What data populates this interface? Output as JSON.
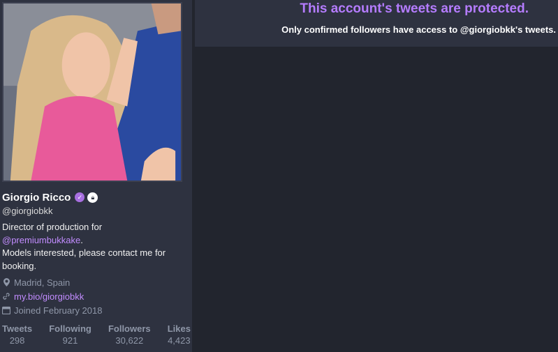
{
  "profile": {
    "fullname": "Giorgio Ricco",
    "handle": "@giorgiobkk",
    "bio_line1": "Director of production for",
    "bio_mention": "@premiumbukkake",
    "bio_after_mention": ".",
    "bio_line2": "Models interested, please contact me for booking.",
    "location": "Madrid, Spain",
    "website": "my.bio/giorgiobkk",
    "joined": "Joined February 2018"
  },
  "stats": [
    {
      "label": "Tweets",
      "value": "298"
    },
    {
      "label": "Following",
      "value": "921"
    },
    {
      "label": "Followers",
      "value": "30,622"
    },
    {
      "label": "Likes",
      "value": "4,423"
    }
  ],
  "protected": {
    "title": "This account's tweets are protected.",
    "subtitle": "Only confirmed followers have access to @giorgiobkk's tweets."
  },
  "icons": {
    "verified": "verified-icon",
    "lock": "lock-icon",
    "location": "location-pin-icon",
    "link": "link-icon",
    "calendar": "calendar-icon"
  },
  "colors": {
    "accent": "#b57cff",
    "link": "#c28cff",
    "sidebar_bg": "#2e3240",
    "page_bg": "#22252e",
    "muted": "#8f97a8"
  }
}
